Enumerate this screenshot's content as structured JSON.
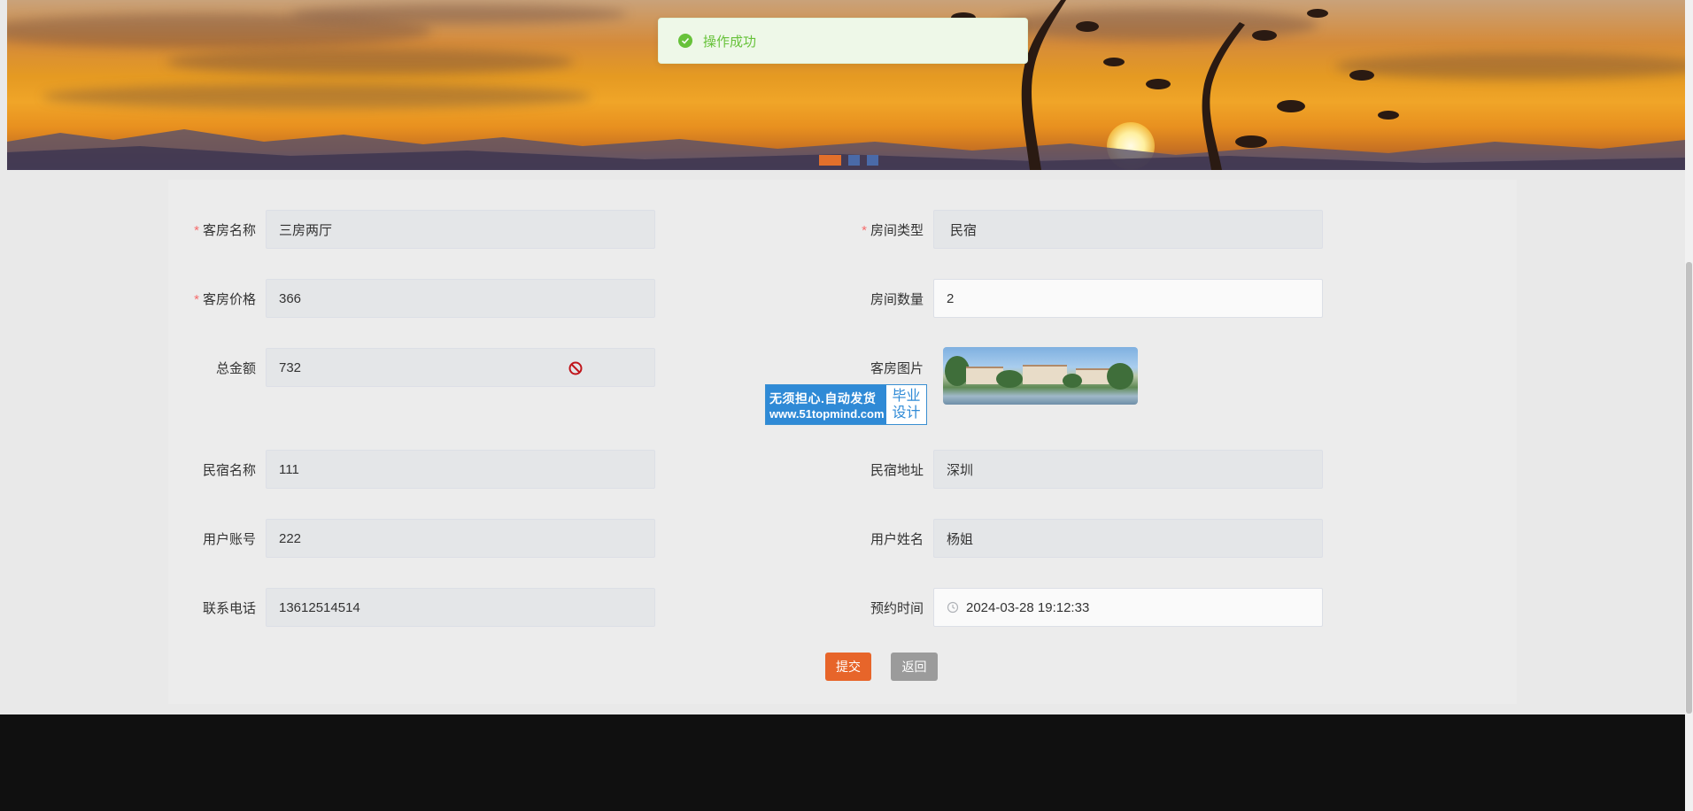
{
  "toast": {
    "message": "操作成功",
    "icon": "check-circle-icon",
    "color": "#67c23a"
  },
  "banner": {
    "slides": 3,
    "active_slide": 1
  },
  "form": {
    "room_name": {
      "label": "客房名称",
      "value": "三房两厅",
      "required": true
    },
    "room_type": {
      "label": "房间类型",
      "value": "民宿",
      "required": true
    },
    "room_price": {
      "label": "客房价格",
      "value": "366",
      "required": true
    },
    "room_count": {
      "label": "房间数量",
      "value": "2"
    },
    "total_amount": {
      "label": "总金额",
      "value": "732"
    },
    "room_image": {
      "label": "客房图片"
    },
    "homestay_name": {
      "label": "民宿名称",
      "value": "111"
    },
    "homestay_address": {
      "label": "民宿地址",
      "value": "深圳"
    },
    "user_account": {
      "label": "用户账号",
      "value": "222"
    },
    "user_name": {
      "label": "用户姓名",
      "value": "杨姐"
    },
    "phone": {
      "label": "联系电话",
      "value": "13612514514"
    },
    "booking_time": {
      "label": "预约时间",
      "value": "2024-03-28 19:12:33"
    }
  },
  "buttons": {
    "submit": "提交",
    "back": "返回"
  },
  "watermark": {
    "line1": "无须担心.自动发货",
    "line2": "www.51topmind.com",
    "right1": "毕业",
    "right2": "设计"
  },
  "colors": {
    "accent": "#e7652a",
    "required": "#f56c6c",
    "footer": "#101010"
  }
}
